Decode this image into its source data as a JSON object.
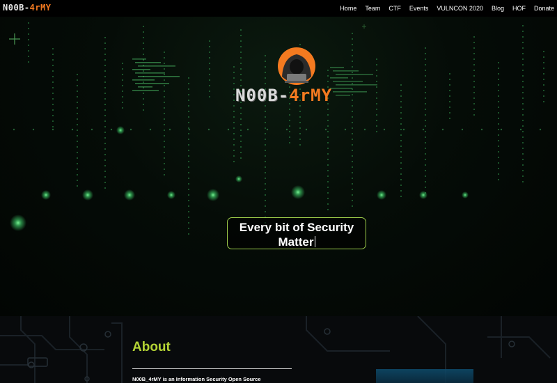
{
  "navbar": {
    "brand_part1": "N00B-",
    "brand_part2": "4rMY",
    "links": [
      "Home",
      "Team",
      "CTF",
      "Events",
      "VULNCON 2020",
      "Blog",
      "HOF",
      "Donate"
    ]
  },
  "hero": {
    "logo_part1": "N00B-",
    "logo_part2": "4rMY",
    "tagline": "Every bit of Security Matter",
    "icons": {
      "logo": "hooded-hacker-icon"
    }
  },
  "about": {
    "title": "About",
    "text": "N00B_4rMY is an Information Security Open Source"
  },
  "colors": {
    "accent_green": "#b4d335",
    "logo_orange": "#f47a20",
    "matrix_green": "#3fd16a"
  }
}
